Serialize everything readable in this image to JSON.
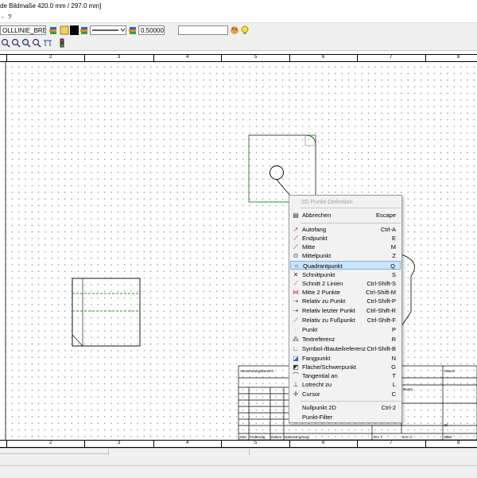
{
  "window": {
    "title": "de Bildmaße 420.0 mm / 297.0 mm]"
  },
  "menubar": {
    "items": [
      "-",
      "?"
    ]
  },
  "toolbar": {
    "layer_value": "OLLLINIE_BREIT",
    "linewidth_value": "0.500000",
    "text_field_value": ""
  },
  "ruler": {
    "labels": [
      "2",
      "3",
      "4",
      "5",
      "6",
      "7",
      "8"
    ]
  },
  "context_menu": {
    "header": "2D Punkt-Definition",
    "items": [
      {
        "label": "Abbrechen",
        "shortcut": "Escape",
        "icon": "cancel-icon"
      },
      {
        "label": "Autofang",
        "shortcut": "Ctrl-A",
        "icon": "autosnap-icon"
      },
      {
        "label": "Endpunkt",
        "shortcut": "E",
        "icon": "endpoint-icon"
      },
      {
        "label": "Mitte",
        "shortcut": "M",
        "icon": "midpoint-icon"
      },
      {
        "label": "Mittelpunkt",
        "shortcut": "Z",
        "icon": "center-icon"
      },
      {
        "label": "Quadrantpunkt",
        "shortcut": "Q",
        "icon": "quadrant-icon",
        "highlighted": true
      },
      {
        "label": "Schnittpunkt",
        "shortcut": "S",
        "icon": "intersection-icon"
      },
      {
        "label": "Schnitt 2 Linien",
        "shortcut": "Ctrl-Shift-S",
        "icon": "intersect-two-lines-icon"
      },
      {
        "label": "Mitte 2 Punkte",
        "shortcut": "Ctrl-Shift-M",
        "icon": "middle-two-points-icon"
      },
      {
        "label": "Relativ zu Punkt",
        "shortcut": "Ctrl-Shift-P",
        "icon": "relative-point-icon"
      },
      {
        "label": "Relativ letzter Punkt",
        "shortcut": "Ctrl-Shift-R",
        "icon": "relative-last-point-icon"
      },
      {
        "label": "Relativ zu Fußpunkt",
        "shortcut": "Ctrl-Shift-F",
        "icon": "relative-foot-point-icon"
      },
      {
        "label": "Punkt",
        "shortcut": "P",
        "icon": "point-icon"
      },
      {
        "label": "Textreferenz",
        "shortcut": "R",
        "icon": "text-reference-icon"
      },
      {
        "label": "Symbol-/Bauteilreferenz",
        "shortcut": "Ctrl-Shift-B",
        "icon": "symbol-reference-icon"
      },
      {
        "label": "Fangpunkt",
        "shortcut": "N",
        "icon": "snap-point-icon"
      },
      {
        "label": "Fläche/Schwerpunkt",
        "shortcut": "G",
        "icon": "centroid-icon"
      },
      {
        "label": "Tangential an",
        "shortcut": "T",
        "icon": "tangent-icon"
      },
      {
        "label": "Lotrecht zu",
        "shortcut": "L",
        "icon": "perpendicular-icon"
      },
      {
        "label": "Cursor",
        "shortcut": "C",
        "icon": "cursor-icon"
      },
      {
        "label": "Nullpunkt 2D",
        "shortcut": "Ctrl-2",
        "icon": ""
      },
      {
        "label": "Punkt-Filter",
        "shortcut": "",
        "icon": ""
      }
    ]
  },
  "title_block": {
    "cells": [
      "Verwendungsbereich",
      "Zust.",
      "Änderung",
      "Datum",
      "Name",
      "Ursprung",
      "Ers. f.",
      "Ers. d.",
      "Blatt",
      "Bl.",
      "Datum",
      "Bearb."
    ]
  }
}
